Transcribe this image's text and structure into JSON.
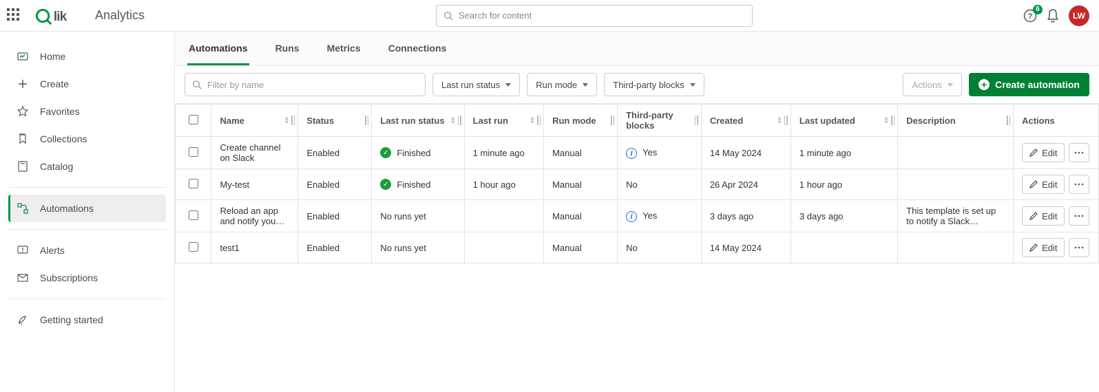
{
  "header": {
    "product": "Qlik",
    "subtitle": "Analytics",
    "search_placeholder": "Search for content",
    "notification_count": "6",
    "avatar_initials": "LW"
  },
  "sidebar": {
    "items": [
      {
        "label": "Home"
      },
      {
        "label": "Create"
      },
      {
        "label": "Favorites"
      },
      {
        "label": "Collections"
      },
      {
        "label": "Catalog"
      },
      {
        "label": "Automations"
      },
      {
        "label": "Alerts"
      },
      {
        "label": "Subscriptions"
      },
      {
        "label": "Getting started"
      }
    ]
  },
  "tabs": [
    {
      "label": "Automations"
    },
    {
      "label": "Runs"
    },
    {
      "label": "Metrics"
    },
    {
      "label": "Connections"
    }
  ],
  "toolbar": {
    "filter_placeholder": "Filter by name",
    "dd_last_run_status": "Last run status",
    "dd_run_mode": "Run mode",
    "dd_tpb": "Third-party blocks",
    "actions_label": "Actions",
    "create_label": "Create automation"
  },
  "table": {
    "columns": {
      "name": "Name",
      "status": "Status",
      "last_run_status": "Last run status",
      "last_run": "Last run",
      "run_mode": "Run mode",
      "tpb": "Third-party blocks",
      "created": "Created",
      "last_updated": "Last updated",
      "description": "Description",
      "actions": "Actions"
    },
    "edit_label": "Edit",
    "rows": [
      {
        "name": "Create channel on Slack",
        "status": "Enabled",
        "last_run_status": "Finished",
        "last_run_status_icon": "check",
        "last_run": "1 minute ago",
        "run_mode": "Manual",
        "tpb": "Yes",
        "tpb_info": true,
        "created": "14 May 2024",
        "last_updated": "1 minute ago",
        "description": ""
      },
      {
        "name": "My-test",
        "status": "Enabled",
        "last_run_status": "Finished",
        "last_run_status_icon": "check",
        "last_run": "1 hour ago",
        "run_mode": "Manual",
        "tpb": "No",
        "tpb_info": false,
        "created": "26 Apr 2024",
        "last_updated": "1 hour ago",
        "description": ""
      },
      {
        "name": "Reload an app and notify you…",
        "status": "Enabled",
        "last_run_status": "No runs yet",
        "last_run_status_icon": "",
        "last_run": "",
        "run_mode": "Manual",
        "tpb": "Yes",
        "tpb_info": true,
        "created": "3 days ago",
        "last_updated": "3 days ago",
        "description": "This template is set up to notify a Slack…"
      },
      {
        "name": "test1",
        "status": "Enabled",
        "last_run_status": "No runs yet",
        "last_run_status_icon": "",
        "last_run": "",
        "run_mode": "Manual",
        "tpb": "No",
        "tpb_info": false,
        "created": "14 May 2024",
        "last_updated": "",
        "description": ""
      }
    ]
  }
}
